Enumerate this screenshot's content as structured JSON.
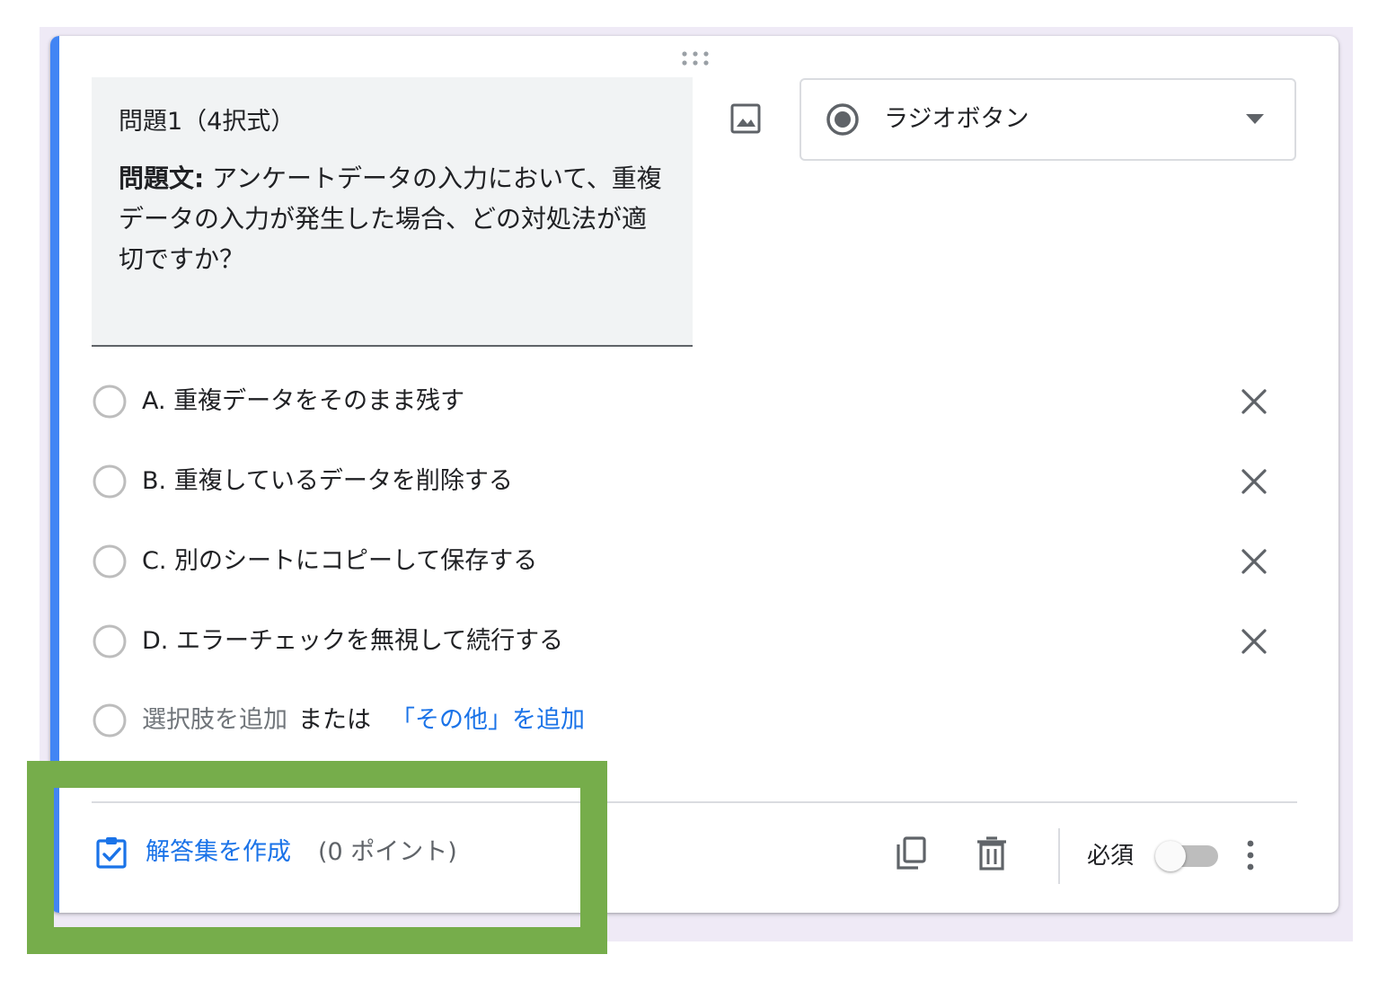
{
  "question": {
    "title": "問題1（4択式）",
    "text_label": "問題文:",
    "text_body": " アンケートデータの入力において、重複データの入力が発生した場合、どの対処法が適切ですか？"
  },
  "type_selector": {
    "selected": "ラジオボタン"
  },
  "options": [
    {
      "label": "A. 重複データをそのまま残す"
    },
    {
      "label": "B. 重複しているデータを削除する"
    },
    {
      "label": "C. 別のシートにコピーして保存する"
    },
    {
      "label": "D. エラーチェックを無視して続行する"
    }
  ],
  "add_option": {
    "add_choice": "選択肢を追加",
    "or_text": "または",
    "add_other": "「その他」を追加"
  },
  "footer": {
    "answer_key_label": "解答集を作成",
    "points_label": "(0 ポイント)",
    "required_label": "必須",
    "required_on": false
  },
  "colors": {
    "accent": "#4285f4",
    "link": "#1a73e8",
    "highlight": "#76ad4b",
    "background": "#efeaf6"
  }
}
